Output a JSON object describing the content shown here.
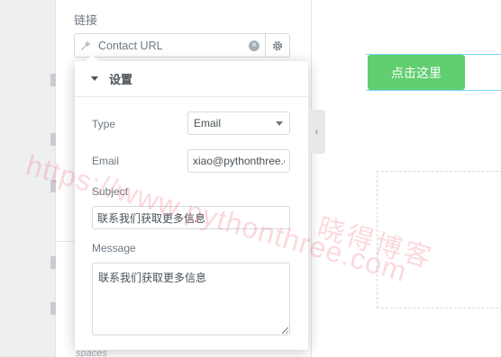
{
  "link_section": {
    "label": "链接",
    "url_value": "Contact URL"
  },
  "popover": {
    "title": "设置",
    "type_label": "Type",
    "type_value": "Email",
    "email_label": "Email",
    "email_value": "xiao@pythonthree.c",
    "subject_label": "Subject",
    "subject_value": "联系我们获取更多信息",
    "message_label": "Message",
    "message_value": "联系我们获取更多信息"
  },
  "partial_label": "spaces",
  "preview": {
    "button_label": "点击这里",
    "button_color": "#61ce70"
  },
  "watermark": {
    "url_text": "https://www.pythonthree.com",
    "brand_text": "晓得博客"
  },
  "icons": {
    "url_icon": "wrench-icon",
    "clear_icon": "clear-icon",
    "settings_icon": "gear-icon",
    "collapse_icon": "chevron-left-icon"
  }
}
